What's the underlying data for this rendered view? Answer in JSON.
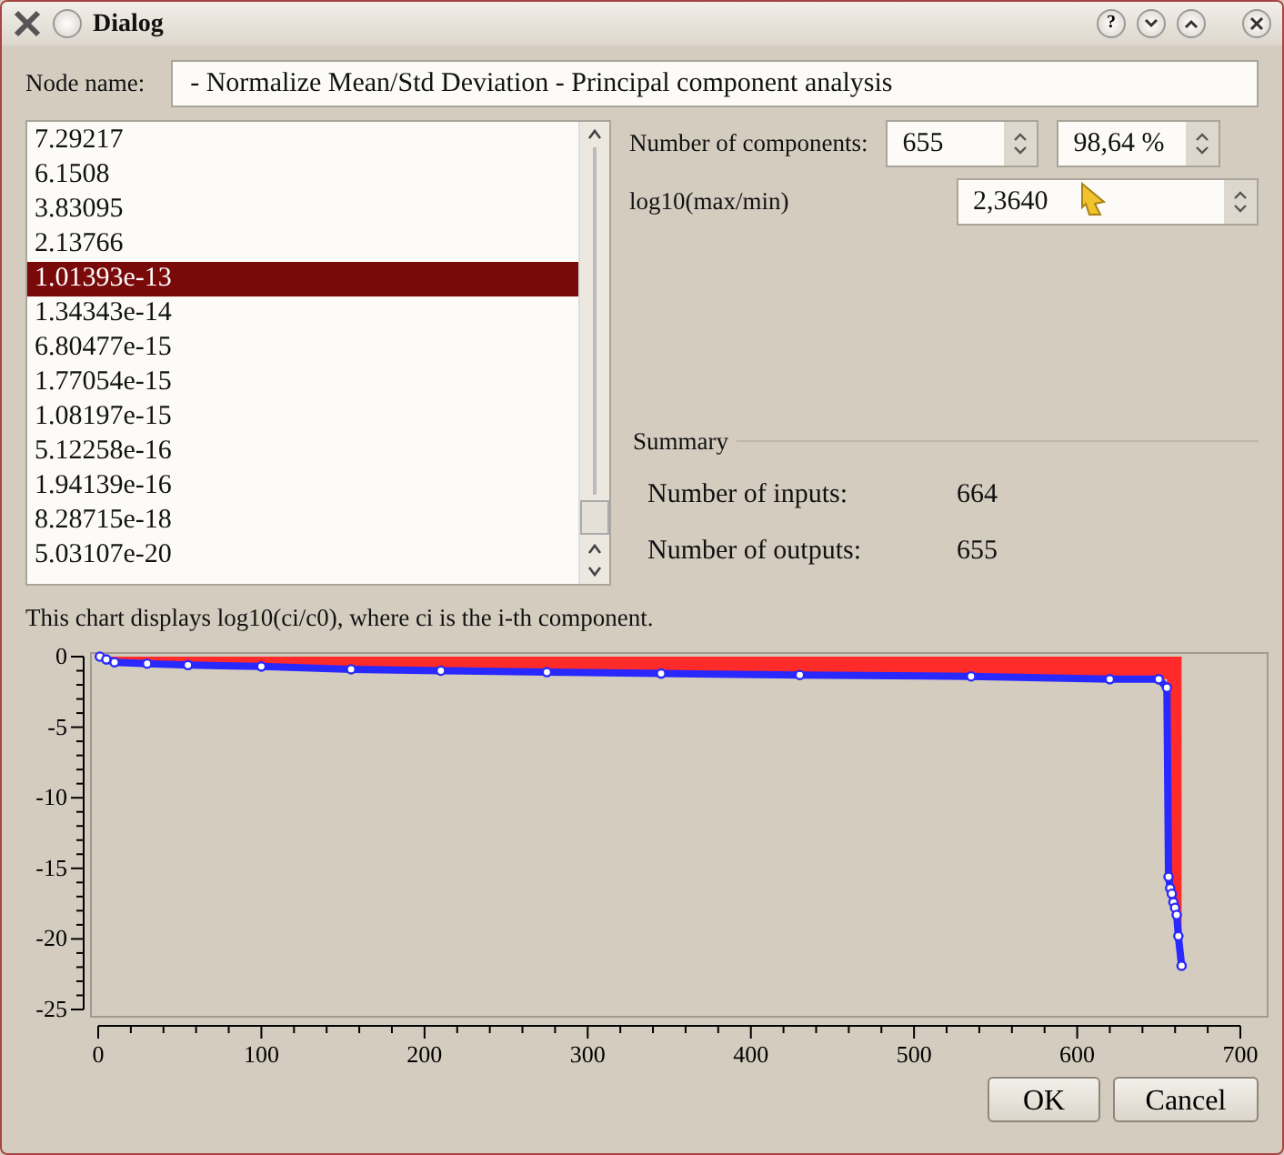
{
  "window": {
    "title": "Dialog",
    "help_button": "?"
  },
  "node_name": {
    "label": "Node name:",
    "value": "- Normalize Mean/Std Deviation - Principal component analysis"
  },
  "eigenvalues": {
    "items": [
      {
        "text": "7.29217",
        "selected": false
      },
      {
        "text": "6.1508",
        "selected": false
      },
      {
        "text": "3.83095",
        "selected": false
      },
      {
        "text": "2.13766",
        "selected": false
      },
      {
        "text": "1.01393e-13",
        "selected": true
      },
      {
        "text": "1.34343e-14",
        "selected": false
      },
      {
        "text": "6.80477e-15",
        "selected": false
      },
      {
        "text": "1.77054e-15",
        "selected": false
      },
      {
        "text": "1.08197e-15",
        "selected": false
      },
      {
        "text": "5.12258e-16",
        "selected": false
      },
      {
        "text": "1.94139e-16",
        "selected": false
      },
      {
        "text": "8.28715e-18",
        "selected": false
      },
      {
        "text": "5.03107e-20",
        "selected": false
      }
    ]
  },
  "components": {
    "label": "Number of components:",
    "count": "655",
    "percent": "98,64 %"
  },
  "log_ratio": {
    "label": "log10(max/min)",
    "value": "2,3640"
  },
  "summary": {
    "title": "Summary",
    "rows": [
      {
        "label": "Number of inputs:",
        "value": "664"
      },
      {
        "label": "Number of outputs:",
        "value": "655"
      }
    ]
  },
  "chart": {
    "caption": "This chart displays log10(ci/c0), where ci is the i-th component.",
    "chart_data": {
      "type": "area",
      "xlim": [
        0,
        700
      ],
      "ylim": [
        -25,
        0
      ],
      "xticks": [
        0,
        100,
        200,
        300,
        400,
        500,
        600,
        700
      ],
      "yticks": [
        0,
        -5,
        -10,
        -15,
        -20,
        -25
      ],
      "x": [
        1,
        5,
        10,
        30,
        55,
        100,
        155,
        210,
        275,
        345,
        430,
        535,
        620,
        650,
        655,
        656,
        657,
        658,
        659,
        660,
        661,
        662,
        664
      ],
      "series": [
        {
          "color": "#2828ff",
          "values": [
            0,
            -0.2,
            -0.4,
            -0.5,
            -0.6,
            -0.7,
            -0.9,
            -1,
            -1.1,
            -1.2,
            -1.3,
            -1.4,
            -1.6,
            -1.6,
            -2.2,
            -15.6,
            -16.4,
            -16.8,
            -17.4,
            -17.8,
            -18.3,
            -19.8,
            -21.9
          ]
        }
      ]
    }
  },
  "buttons": [
    "OK",
    "Cancel"
  ]
}
